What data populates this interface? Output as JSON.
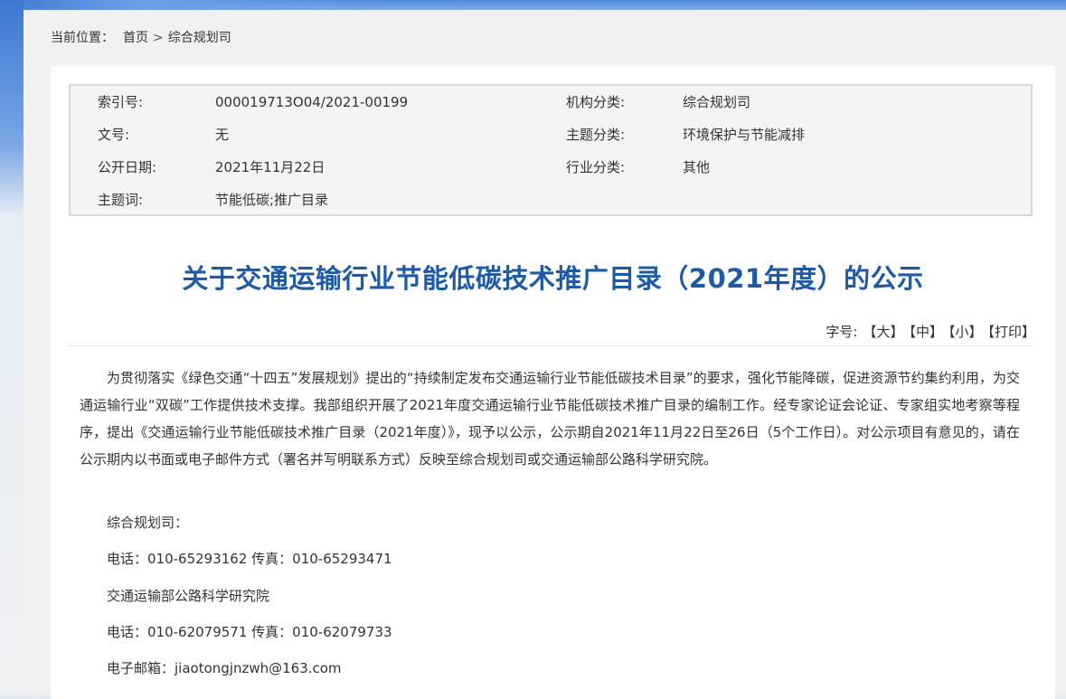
{
  "breadcrumb": {
    "label": "当前位置：",
    "home": "首页",
    "separator": ">",
    "current": "综合规划司"
  },
  "meta": {
    "index_label": "索引号:",
    "index_value": "000019713O04/2021-00199",
    "org_label": "机构分类:",
    "org_value": "综合规划司",
    "docno_label": "文号:",
    "docno_value": "无",
    "topic_label": "主题分类:",
    "topic_value": "环境保护与节能减排",
    "date_label": "公开日期:",
    "date_value": "2021年11月22日",
    "industry_label": "行业分类:",
    "industry_value": "其他",
    "keywords_label": "主题词:",
    "keywords_value": "节能低碳;推广目录"
  },
  "article": {
    "title": "关于交通运输行业节能低碳技术推广目录（2021年度）的公示",
    "paragraph": "为贯彻落实《绿色交通“十四五”发展规划》提出的“持续制定发布交通运输行业节能低碳技术目录”的要求，强化节能降碳，促进资源节约集约利用，为交通运输行业“双碳”工作提供技术支撑。我部组织开展了2021年度交通运输行业节能低碳技术推广目录的编制工作。经专家论证会论证、专家组实地考察等程序，提出《交通运输行业节能低碳技术推广目录（2021年度）》，现予以公示，公示期自2021年11月22日至26日（5个工作日）。对公示项目有意见的，请在公示期内以书面或电子邮件方式（署名并写明联系方式）反映至综合规划司或交通运输部公路科学研究院。",
    "contact1_org": "综合规划司：",
    "contact1_phone": "电话：010-65293162 传真：010-65293471",
    "contact2_org": "交通运输部公路科学研究院",
    "contact2_phone": "电话：010-62079571 传真：010-62079733",
    "email": "电子邮箱：jiaotongjnzwh@163.com"
  },
  "font_size": {
    "label": "字号:",
    "large": "【大】",
    "medium": "【中】",
    "small": "【小】",
    "print": "【打印】"
  },
  "colors": {
    "title": "#1f5aa6",
    "text": "#333333",
    "meta_bg": "#f4f4f4"
  }
}
